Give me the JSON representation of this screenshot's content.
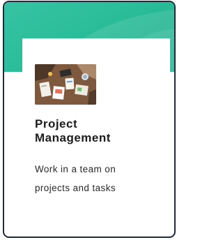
{
  "card": {
    "title": "Project\nManagement",
    "description": "Work in a team on projects and tasks",
    "image": "team-desk-collaboration-photo",
    "colors": {
      "banner": "#2bbd9a",
      "border": "#1e2b3a",
      "title_text": "#1c1c1c",
      "body_text": "#2a2a2a"
    }
  }
}
